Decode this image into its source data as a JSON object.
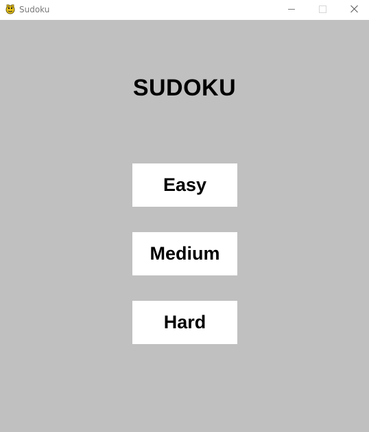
{
  "window": {
    "title": "Sudoku",
    "icon": "pygame-snake-icon"
  },
  "controls": {
    "minimize_icon": "minimize-icon",
    "maximize_icon": "maximize-icon",
    "close_icon": "close-icon"
  },
  "main": {
    "heading": "SUDOKU",
    "difficulties": [
      {
        "label": "Easy"
      },
      {
        "label": "Medium"
      },
      {
        "label": "Hard"
      }
    ]
  },
  "colors": {
    "background": "#c0c0c0",
    "button_bg": "#ffffff",
    "text": "#000000"
  }
}
